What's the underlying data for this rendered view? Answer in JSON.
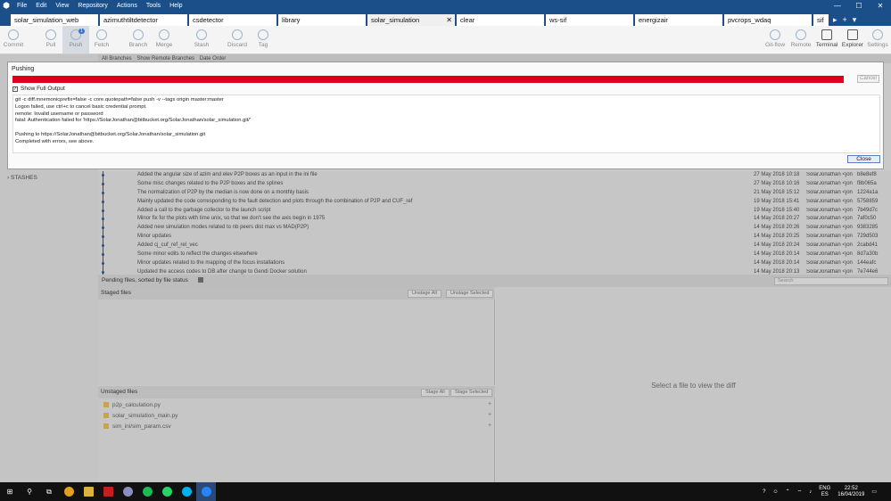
{
  "menu": [
    "File",
    "Edit",
    "View",
    "Repository",
    "Actions",
    "Tools",
    "Help"
  ],
  "tabs": [
    {
      "label": "solar_simulation_web",
      "active": false
    },
    {
      "label": "azimuthtiltdetector",
      "active": false
    },
    {
      "label": "csdetector",
      "active": false
    },
    {
      "label": "library",
      "active": false
    },
    {
      "label": "solar_simulation",
      "active": true
    },
    {
      "label": "clear",
      "active": false
    },
    {
      "label": "ws-sif",
      "active": false
    },
    {
      "label": "energizair",
      "active": false
    },
    {
      "label": "pvcrops_wdaq",
      "active": false
    },
    {
      "label": "sif",
      "active": false
    }
  ],
  "toolbar": {
    "commit": "Commit",
    "pull": "Pull",
    "push": "Push",
    "push_badge": "1",
    "fetch": "Fetch",
    "branch": "Branch",
    "merge": "Merge",
    "stash": "Stash",
    "discard": "Discard",
    "tag": "Tag",
    "gitflow": "Git-flow",
    "remote": "Remote",
    "terminal": "Terminal",
    "explorer": "Explorer",
    "settings": "Settings"
  },
  "filterbar": {
    "branches": "All Branches",
    "remote": "Show Remote Branches",
    "order": "Date Order"
  },
  "sidebar": {
    "stashes": "STASHES"
  },
  "commits": [
    {
      "msg": "Added the angular size of azim and elev P2P boxes as an input in the ini file",
      "date": "27 May 2018 10:18",
      "author": "SolarJonathan <jon",
      "hash": "b8e8ef8"
    },
    {
      "msg": "Some misc changes related to the P2P boxes and the splines",
      "date": "27 May 2018 10:16",
      "author": "SolarJonathan <jon",
      "hash": "f8b065a"
    },
    {
      "msg": "The normalization of P2P by the median is now done on a monthly basis",
      "date": "21 May 2018 15:12",
      "author": "SolarJonathan <jon",
      "hash": "1224a1a"
    },
    {
      "msg": "Mainly updated the code corresponding to the fault detection and plots through the combination of P2P and CUF_ref",
      "date": "19 May 2018 15:41",
      "author": "SolarJonathan <jon",
      "hash": "5758859"
    },
    {
      "msg": "Added a call to the garbage collector to the launch script",
      "date": "19 May 2018 15:40",
      "author": "SolarJonathan <jon",
      "hash": "7b49d7c"
    },
    {
      "msg": "Minor fix for the plots with time unix, so that we don't see the axis begin in 1975",
      "date": "14 May 2018 20:27",
      "author": "SolarJonathan <jon",
      "hash": "7af0c50"
    },
    {
      "msg": "Added new simulation modes related to nb peers dist max vs MAD(P2P)",
      "date": "14 May 2018 20:26",
      "author": "SolarJonathan <jon",
      "hash": "9383285"
    },
    {
      "msg": "Minor updates",
      "date": "14 May 2018 20:25",
      "author": "SolarJonathan <jon",
      "hash": "729d503"
    },
    {
      "msg": "Added cj_cuf_ref_rel_vec",
      "date": "14 May 2018 20:24",
      "author": "SolarJonathan <jon",
      "hash": "2cabd41"
    },
    {
      "msg": "Some minor edits to reflect the changes elsewhere",
      "date": "14 May 2018 20:14",
      "author": "SolarJonathan <jon",
      "hash": "8d7a30b"
    },
    {
      "msg": "Minor updates related to the mapping of the focus installations",
      "date": "14 May 2018 20:14",
      "author": "SolarJonathan <jon",
      "hash": "144eafc"
    },
    {
      "msg": "Updated the access codes to DB after change to Gendi Docker solution",
      "date": "14 May 2018 20:13",
      "author": "SolarJonathan <jon",
      "hash": "7e744e6"
    }
  ],
  "pending": {
    "title": "Pending files, sorted by file status",
    "search_placeholder": "Search"
  },
  "staged": {
    "title": "Staged files",
    "unstage_all": "Unstage All",
    "unstage_selected": "Unstage Selected"
  },
  "unstaged": {
    "title": "Unstaged files",
    "stage_all": "Stage All",
    "stage_selected": "Stage Selected",
    "files": [
      "p2p_calculation.py",
      "solar_simulation_main.py",
      "sim_ini/sim_param.csv"
    ]
  },
  "diff": {
    "placeholder": "Select a file to view the diff"
  },
  "modal": {
    "title": "Pushing",
    "cancel": "Cancel",
    "show_full_output": "Show Full Output",
    "output": "git -c diff.mnemonicprefix=false -c core.quotepath=false push -v --tags origin master:master\nLogon failed, use ctrl+c to cancel basic credential prompt.\nremote: Invalid username or password\nfatal: Authentication failed for 'https://SolarJonathan@bitbucket.org/SolarJonathan/solar_simulation.git/'\n\nPushing to https://SolarJonathan@bitbucket.org/SolarJonathan/solar_simulation.git\nCompleted with errors, see above.",
    "close": "Close",
    "error_color": "#d9001f"
  },
  "taskbar": {
    "lang1": "ENG",
    "lang2": "ES",
    "time": "22:52",
    "date": "16/04/2019"
  }
}
